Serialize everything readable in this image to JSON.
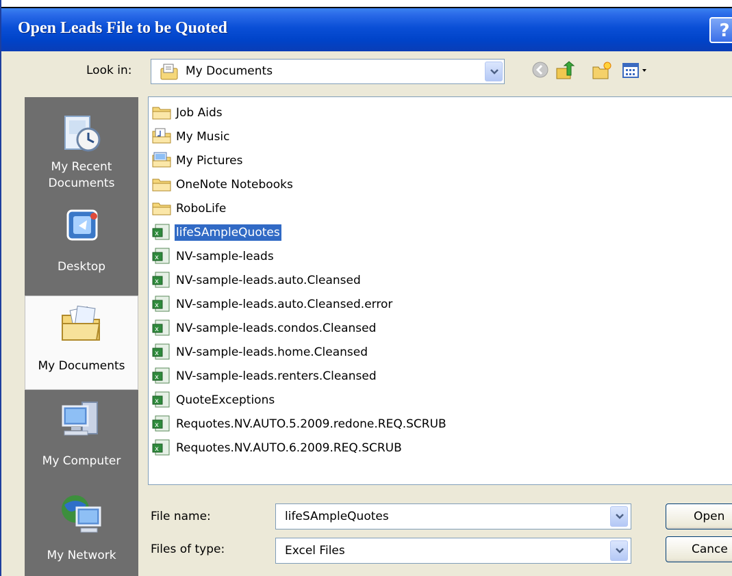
{
  "dialog": {
    "title": "Open Leads File to be Quoted",
    "help_label": "?"
  },
  "look_in": {
    "label": "Look in:",
    "value": "My Documents"
  },
  "places": [
    {
      "label_line1": "My Recent",
      "label_line2": "Documents",
      "icon": "recent-documents-icon"
    },
    {
      "label_line1": "Desktop",
      "icon": "desktop-icon"
    },
    {
      "label_line1": "My Documents",
      "icon": "my-documents-icon"
    },
    {
      "label_line1": "My Computer",
      "icon": "my-computer-icon"
    },
    {
      "label_line1": "My Network",
      "icon": "my-network-icon"
    }
  ],
  "files": [
    {
      "name": "Job Aids",
      "type": "folder"
    },
    {
      "name": "My Music",
      "type": "music-folder"
    },
    {
      "name": "My Pictures",
      "type": "pictures-folder"
    },
    {
      "name": "OneNote Notebooks",
      "type": "folder"
    },
    {
      "name": "RoboLife",
      "type": "folder"
    },
    {
      "name": "lifeSAmpleQuotes",
      "type": "excel",
      "selected": true
    },
    {
      "name": "NV-sample-leads",
      "type": "excel"
    },
    {
      "name": "NV-sample-leads.auto.Cleansed",
      "type": "excel"
    },
    {
      "name": "NV-sample-leads.auto.Cleansed.error",
      "type": "excel"
    },
    {
      "name": "NV-sample-leads.condos.Cleansed",
      "type": "excel"
    },
    {
      "name": "NV-sample-leads.home.Cleansed",
      "type": "excel"
    },
    {
      "name": "NV-sample-leads.renters.Cleansed",
      "type": "excel"
    },
    {
      "name": "QuoteExceptions",
      "type": "excel"
    },
    {
      "name": "Requotes.NV.AUTO.5.2009.redone.REQ.SCRUB",
      "type": "excel"
    },
    {
      "name": "Requotes.NV.AUTO.6.2009.REQ.SCRUB",
      "type": "excel"
    }
  ],
  "file_name": {
    "label": "File name:",
    "value": "lifeSAmpleQuotes"
  },
  "file_type": {
    "label": "Files of type:",
    "value": "Excel Files"
  },
  "buttons": {
    "open": "Open",
    "cancel": "Cance"
  },
  "colors": {
    "title_blue": "#0a4fd6",
    "selection": "#316ac5",
    "dialog_bg": "#ece9d8"
  }
}
